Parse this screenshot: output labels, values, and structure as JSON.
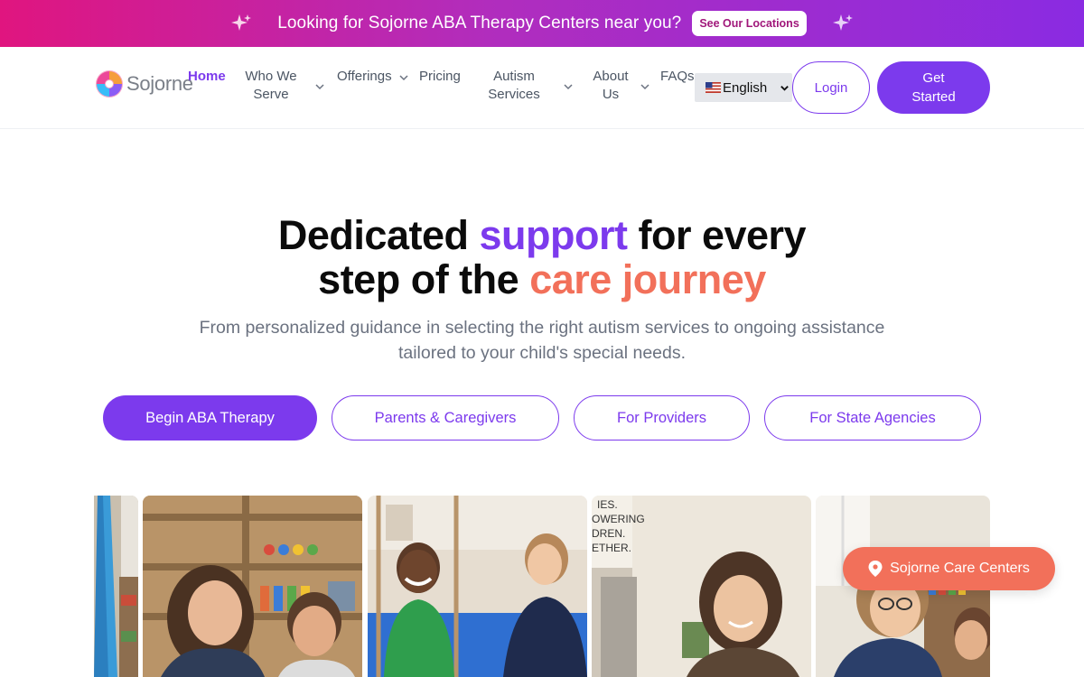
{
  "announcement": {
    "text": "Looking for Sojorne ABA Therapy Centers near you?",
    "button_label": "See Our Locations"
  },
  "nav": {
    "logo_text": "Sojorne",
    "items": [
      {
        "label": "Home",
        "active": true
      },
      {
        "label": "Who We Serve",
        "dropdown": true
      },
      {
        "label": "Offerings",
        "dropdown": true
      },
      {
        "label": "Pricing"
      },
      {
        "label": "Autism Services",
        "dropdown": true
      },
      {
        "label": "About Us",
        "dropdown": true
      },
      {
        "label": "FAQs"
      }
    ],
    "language_select": {
      "flag_icon": "us-flag-icon",
      "selected": "English"
    },
    "login_label": "Login",
    "get_started_label": "Get Started"
  },
  "hero": {
    "title_part1": "Dedicated ",
    "title_highlight1": "support",
    "title_part2": " for every",
    "title_part3": "step of the ",
    "title_highlight2": "care journey",
    "subtitle": "From personalized guidance in selecting the right autism services to ongoing assistance tailored to your child's special needs.",
    "ctas": [
      {
        "label": "Begin ABA Therapy",
        "style": "primary"
      },
      {
        "label": "Parents & Caregivers",
        "style": "outline"
      },
      {
        "label": "For Providers",
        "style": "outline"
      },
      {
        "label": "For State Agencies",
        "style": "outline"
      }
    ]
  },
  "gallery": {
    "photos": [
      "therapy-room-photo",
      "therapist-with-boy-photo",
      "boy-on-swing-photo",
      "smiling-therapist-photo",
      "therapist-reading-photo"
    ],
    "poster_text": "ES.\nOWERING\nDREN.\nETHER."
  },
  "floating_button": {
    "label": "Sojorne Care Centers",
    "icon": "location-pin-icon"
  },
  "colors": {
    "primary": "#7c3aed",
    "coral": "#f2705a",
    "announcement_gradient_start": "#e0157f",
    "announcement_gradient_end": "#8a2be2"
  }
}
